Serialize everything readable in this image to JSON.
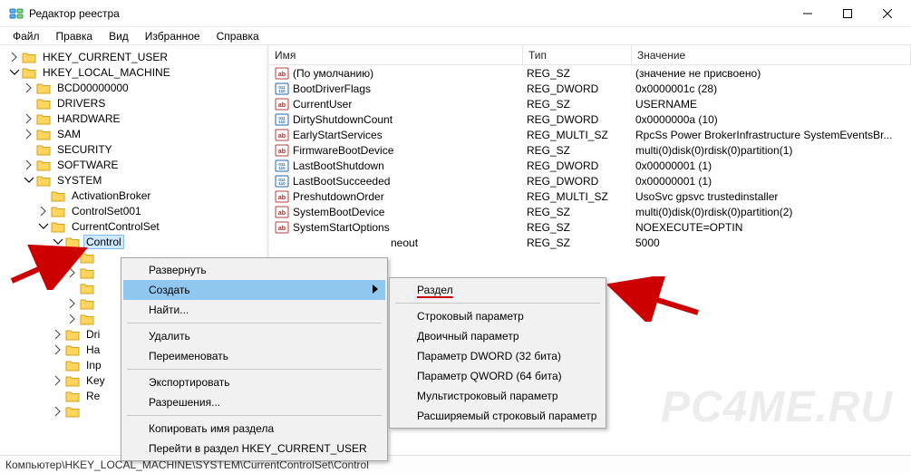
{
  "window": {
    "title": "Редактор реестра"
  },
  "menubar": {
    "file": "Файл",
    "edit": "Правка",
    "view": "Вид",
    "favorites": "Избранное",
    "help": "Справка"
  },
  "tree": {
    "hkcu": "HKEY_CURRENT_USER",
    "hklm": "HKEY_LOCAL_MACHINE",
    "bcd": "BCD00000000",
    "drivers": "DRIVERS",
    "hardware": "HARDWARE",
    "sam": "SAM",
    "security": "SECURITY",
    "software": "SOFTWARE",
    "system": "SYSTEM",
    "activationbroker": "ActivationBroker",
    "controlset001": "ControlSet001",
    "currentcontrolset": "CurrentControlSet",
    "control": "Control",
    "drivers2": "Dri",
    "hardware2": "Ha",
    "input": "Inp",
    "key": "Key",
    "reg": "Re"
  },
  "columns": {
    "name": "Имя",
    "type": "Тип",
    "value": "Значение"
  },
  "values": [
    {
      "icon": "str",
      "name": "(По умолчанию)",
      "type": "REG_SZ",
      "value": "(значение не присвоено)"
    },
    {
      "icon": "bin",
      "name": "BootDriverFlags",
      "type": "REG_DWORD",
      "value": "0x0000001c (28)"
    },
    {
      "icon": "str",
      "name": "CurrentUser",
      "type": "REG_SZ",
      "value": "USERNAME"
    },
    {
      "icon": "bin",
      "name": "DirtyShutdownCount",
      "type": "REG_DWORD",
      "value": "0x0000000a (10)"
    },
    {
      "icon": "str",
      "name": "EarlyStartServices",
      "type": "REG_MULTI_SZ",
      "value": "RpcSs Power BrokerInfrastructure SystemEventsBr..."
    },
    {
      "icon": "str",
      "name": "FirmwareBootDevice",
      "type": "REG_SZ",
      "value": "multi(0)disk(0)rdisk(0)partition(1)"
    },
    {
      "icon": "bin",
      "name": "LastBootShutdown",
      "type": "REG_DWORD",
      "value": "0x00000001 (1)"
    },
    {
      "icon": "bin",
      "name": "LastBootSucceeded",
      "type": "REG_DWORD",
      "value": "0x00000001 (1)"
    },
    {
      "icon": "str",
      "name": "PreshutdownOrder",
      "type": "REG_MULTI_SZ",
      "value": "UsoSvc gpsvc trustedinstaller"
    },
    {
      "icon": "str",
      "name": "SystemBootDevice",
      "type": "REG_SZ",
      "value": "multi(0)disk(0)rdisk(0)partition(2)"
    },
    {
      "icon": "str",
      "name": "SystemStartOptions",
      "type": "REG_SZ",
      "value": " NOEXECUTE=OPTIN"
    },
    {
      "icon": "str",
      "name_trunc": "neout",
      "type": "REG_SZ",
      "value": "5000"
    }
  ],
  "context_menu": {
    "expand": "Развернуть",
    "create": "Создать",
    "find": "Найти...",
    "delete": "Удалить",
    "rename": "Переименовать",
    "export": "Экспортировать",
    "permissions": "Разрешения...",
    "copykey": "Копировать имя раздела",
    "goto": "Перейти в раздел HKEY_CURRENT_USER"
  },
  "submenu": {
    "key": "Раздел",
    "string": "Строковый параметр",
    "binary": "Двоичный параметр",
    "dword": "Параметр DWORD (32 бита)",
    "qword": "Параметр QWORD (64 бита)",
    "multistring": "Мультистроковый параметр",
    "expand": "Расширяемый строковый параметр"
  },
  "statusbar": {
    "path": "Компьютер\\HKEY_LOCAL_MACHINE\\SYSTEM\\CurrentControlSet\\Control"
  },
  "watermark": "PC4ME.RU"
}
